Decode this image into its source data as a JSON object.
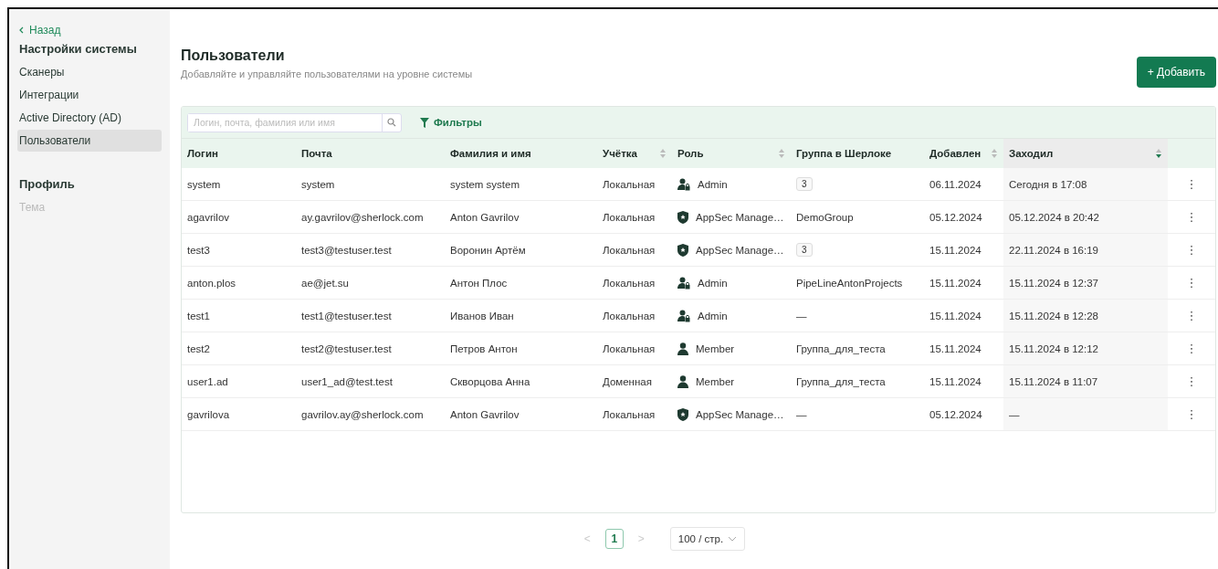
{
  "sidebar": {
    "back": "Назад",
    "sections": [
      {
        "title": "Настройки системы",
        "items": [
          {
            "label": "Сканеры",
            "selected": false,
            "disabled": false
          },
          {
            "label": "Интеграции",
            "selected": false,
            "disabled": false
          },
          {
            "label": "Active Directory (AD)",
            "selected": false,
            "disabled": false
          },
          {
            "label": "Пользователи",
            "selected": true,
            "disabled": false
          }
        ]
      },
      {
        "title": "Профиль",
        "items": [
          {
            "label": "Тема",
            "selected": false,
            "disabled": true
          }
        ]
      }
    ]
  },
  "page": {
    "title": "Пользователи",
    "subtitle": "Добавляйте и управляйте пользователями на уровне системы",
    "add_button": "+ Добавить"
  },
  "toolbar": {
    "search": {
      "placeholder": "Логин, почта, фамилия или имя"
    },
    "filters": "Фильтры"
  },
  "table": {
    "columns": [
      {
        "label": "Логин",
        "sortable": false,
        "selected": false
      },
      {
        "label": "Почта",
        "sortable": false,
        "selected": false
      },
      {
        "label": "Фамилия и имя",
        "sortable": false,
        "selected": false
      },
      {
        "label": "Учётка",
        "sortable": true,
        "selected": false
      },
      {
        "label": "Роль",
        "sortable": true,
        "selected": false
      },
      {
        "label": "Группа в Шерлоке",
        "sortable": false,
        "selected": false
      },
      {
        "label": "Добавлен",
        "sortable": true,
        "selected": false
      },
      {
        "label": "Заходил",
        "sortable": true,
        "selected": true
      }
    ],
    "rows": [
      {
        "login": "system",
        "email": "system",
        "name": "system system",
        "account": "Локальная",
        "role": {
          "kind": "admin",
          "label": "Admin"
        },
        "group": {
          "kind": "count",
          "text": "3"
        },
        "added": "06.11.2024",
        "last_login": "Сегодня в 17:08",
        "menu": "⋮"
      },
      {
        "login": "agavrilov",
        "email": "ay.gavrilov@sherlock.com",
        "name": "Anton Gavrilov",
        "account": "Локальная",
        "role": {
          "kind": "appsec",
          "label": "AppSec Manage…"
        },
        "group": {
          "kind": "text",
          "text": "DemoGroup"
        },
        "added": "05.12.2024",
        "last_login": "05.12.2024 в 20:42",
        "menu": "⋮"
      },
      {
        "login": "test3",
        "email": "test3@testuser.test",
        "name": "Воронин Артём",
        "account": "Локальная",
        "role": {
          "kind": "appsec",
          "label": "AppSec Manage…"
        },
        "group": {
          "kind": "count",
          "text": "3"
        },
        "added": "15.11.2024",
        "last_login": "22.11.2024 в 16:19",
        "menu": "⋮"
      },
      {
        "login": "anton.plos",
        "email": "ae@jet.su",
        "name": "Антон Плос",
        "account": "Локальная",
        "role": {
          "kind": "admin",
          "label": "Admin"
        },
        "group": {
          "kind": "text",
          "text": "PipeLineAntonProjects"
        },
        "added": "15.11.2024",
        "last_login": "15.11.2024 в 12:37",
        "menu": "⋮"
      },
      {
        "login": "test1",
        "email": "test1@testuser.test",
        "name": "Иванов Иван",
        "account": "Локальная",
        "role": {
          "kind": "admin",
          "label": "Admin"
        },
        "group": {
          "kind": "text",
          "text": "—"
        },
        "added": "15.11.2024",
        "last_login": "15.11.2024 в 12:28",
        "menu": "⋮"
      },
      {
        "login": "test2",
        "email": "test2@testuser.test",
        "name": "Петров Антон",
        "account": "Локальная",
        "role": {
          "kind": "member",
          "label": "Member"
        },
        "group": {
          "kind": "text",
          "text": "Группа_для_теста"
        },
        "added": "15.11.2024",
        "last_login": "15.11.2024 в 12:12",
        "menu": "⋮"
      },
      {
        "login": "user1.ad",
        "email": "user1_ad@test.test",
        "name": "Скворцова Анна",
        "account": "Доменная",
        "role": {
          "kind": "member",
          "label": "Member"
        },
        "group": {
          "kind": "text",
          "text": "Группа_для_теста"
        },
        "added": "15.11.2024",
        "last_login": "15.11.2024 в 11:07",
        "menu": "⋮"
      },
      {
        "login": "gavrilova",
        "email": "gavrilov.ay@sherlock.com",
        "name": "Anton Gavrilov",
        "account": "Локальная",
        "role": {
          "kind": "appsec",
          "label": "AppSec Manage…"
        },
        "group": {
          "kind": "text",
          "text": "—"
        },
        "added": "05.12.2024",
        "last_login": "—",
        "menu": "⋮"
      }
    ]
  },
  "pagination": {
    "prev": "<",
    "pages": [
      {
        "label": "1",
        "selected": true
      }
    ],
    "next": ">",
    "page_size": "100 / стр."
  }
}
